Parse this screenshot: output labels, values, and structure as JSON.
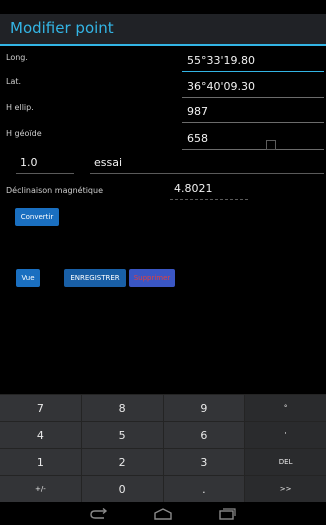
{
  "dialog": {
    "title": "Modifier point"
  },
  "fields": {
    "longitude": {
      "label": "Long.",
      "value": "55°33'19.80"
    },
    "latitude": {
      "label": "Lat.",
      "value": "36°40'09.30"
    },
    "h_ellip": {
      "label": "H ellip.",
      "value": "987"
    },
    "h_geoide": {
      "label": "H géoïde",
      "value": "658"
    },
    "code": {
      "value": "1.0"
    },
    "name": {
      "value": "essai"
    },
    "declinaison": {
      "label": "Déclinaison magnétique",
      "value": "4.8021"
    }
  },
  "buttons": {
    "convertir": "Convertir",
    "vue": "Vue",
    "enregistrer": "ENREGISTRER",
    "supprimer": "Supprimer"
  },
  "keypad": {
    "rows": [
      [
        "7",
        "8",
        "9",
        "°"
      ],
      [
        "4",
        "5",
        "6",
        "'"
      ],
      [
        "1",
        "2",
        "3",
        "DEL"
      ],
      [
        "+/-",
        "0",
        ".",
        ">>"
      ]
    ]
  },
  "colors": {
    "accent": "#33b5e5",
    "button_blue": "#1a6fc0",
    "supprimer_text": "#e04040"
  },
  "navbar": {
    "icons": [
      "back-icon",
      "home-icon",
      "recents-icon"
    ]
  }
}
